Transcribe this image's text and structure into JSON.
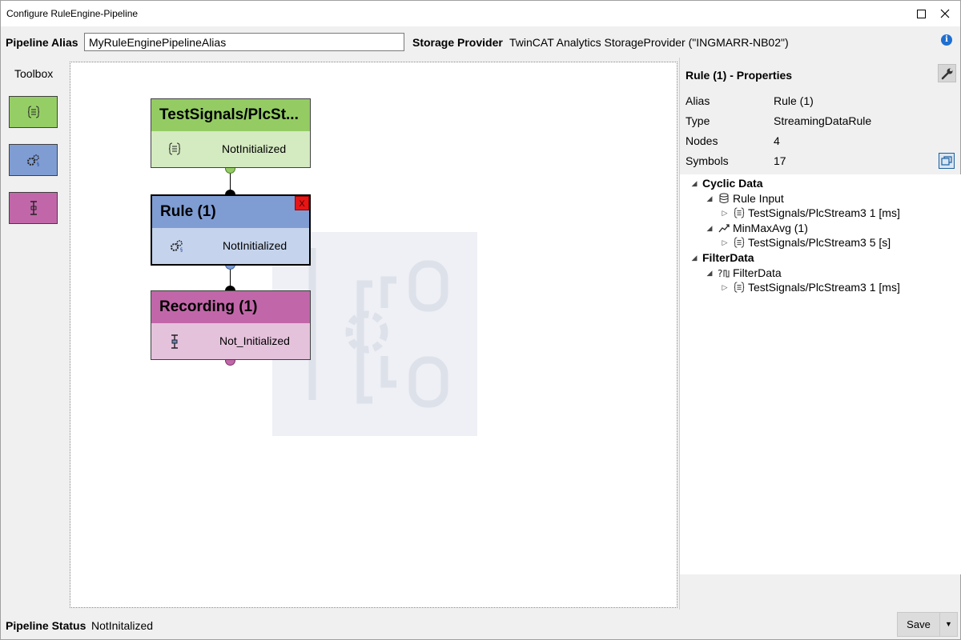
{
  "window": {
    "title": "Configure RuleEngine-Pipeline"
  },
  "top": {
    "alias_label": "Pipeline Alias",
    "alias_value": "MyRuleEnginePipelineAlias",
    "storage_label": "Storage Provider",
    "storage_value": "TwinCAT Analytics StorageProvider (\"INGMARR-NB02\")"
  },
  "toolbox": {
    "title": "Toolbox",
    "items": [
      {
        "name": "signal",
        "icon": "signal-icon",
        "color": "#96ce66"
      },
      {
        "name": "rule",
        "icon": "gears-icon",
        "color": "#7f9dd3"
      },
      {
        "name": "recording",
        "icon": "recording-icon",
        "color": "#c167a9"
      }
    ]
  },
  "nodes": {
    "signal": {
      "title": "TestSignals/PlcSt...",
      "status": "NotInitialized",
      "color": "#94cc63"
    },
    "rule": {
      "title": "Rule (1)",
      "status": "NotInitialized",
      "close": "X",
      "color": "#7f9dd3"
    },
    "recording": {
      "title": "Recording (1)",
      "status": "Not_Initialized",
      "color": "#c167a9"
    }
  },
  "properties": {
    "title": "Rule (1) - Properties",
    "rows": [
      {
        "key": "Alias",
        "value": "Rule (1)"
      },
      {
        "key": "Type",
        "value": "StreamingDataRule"
      },
      {
        "key": "Nodes",
        "value": "4"
      },
      {
        "key": "Symbols",
        "value": "17"
      }
    ],
    "tree": [
      {
        "label": "Cyclic Data"
      },
      {
        "label": "Rule Input"
      },
      {
        "label": "TestSignals/PlcStream3  1 [ms]"
      },
      {
        "label": "MinMaxAvg (1)"
      },
      {
        "label": "TestSignals/PlcStream3  5 [s]"
      },
      {
        "label": "FilterData"
      },
      {
        "label": "FilterData"
      },
      {
        "label": "TestSignals/PlcStream3  1 [ms]"
      }
    ]
  },
  "status": {
    "label": "Pipeline Status",
    "value": "NotInitalized",
    "save_label": "Save"
  }
}
